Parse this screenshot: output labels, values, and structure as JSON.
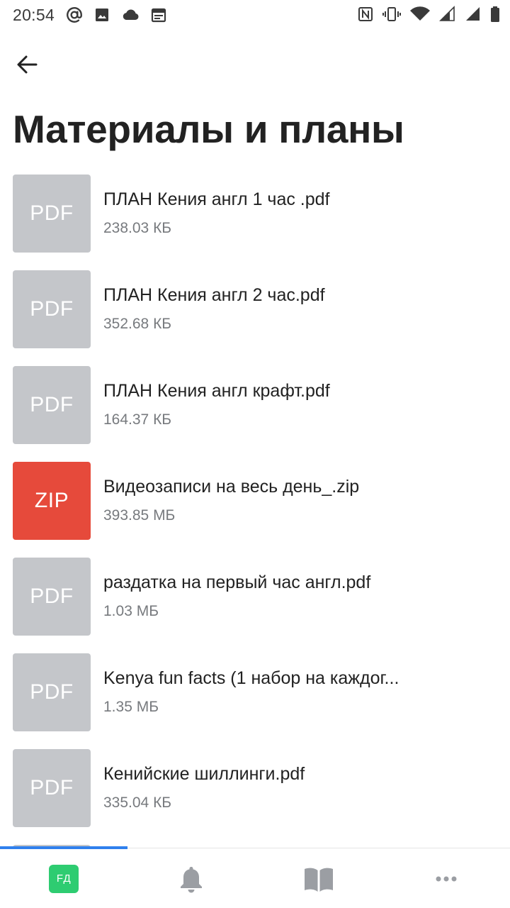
{
  "status_bar": {
    "time": "20:54",
    "left_icons": [
      "at-sign-icon",
      "image-icon",
      "cloud-icon",
      "calendar-icon"
    ],
    "right_icons": [
      "nfc-icon",
      "vibrate-icon",
      "wifi-icon",
      "signal-1-icon",
      "signal-2-icon",
      "battery-icon"
    ]
  },
  "header": {
    "back_icon": "arrow-left-icon",
    "title": "Материалы и планы"
  },
  "files": [
    {
      "type": "PDF",
      "name": "ПЛАН Кения англ 1 час .pdf",
      "size": "238.03 КБ"
    },
    {
      "type": "PDF",
      "name": "ПЛАН Кения англ 2 час.pdf",
      "size": "352.68 КБ"
    },
    {
      "type": "PDF",
      "name": "ПЛАН Кения англ крафт.pdf",
      "size": "164.37 КБ"
    },
    {
      "type": "ZIP",
      "name": "Видеозаписи на весь день_.zip",
      "size": "393.85 МБ"
    },
    {
      "type": "PDF",
      "name": "раздатка на первый час англ.pdf",
      "size": "1.03 МБ"
    },
    {
      "type": "PDF",
      "name": "Kenya fun facts (1 набор на каждог...",
      "size": "1.35 МБ"
    },
    {
      "type": "PDF",
      "name": "Кенийские шиллинги.pdf",
      "size": "335.04 КБ"
    }
  ],
  "colors": {
    "thumb_default": "#c4c6ca",
    "thumb_zip": "#e64a3b",
    "accent": "#2f80ed",
    "avatar": "#2ecc71",
    "nav_icon": "#9b9ea3"
  },
  "bottom_nav": {
    "scroll_progress": 0.25,
    "avatar_initials": "FД",
    "items": [
      "profile-avatar",
      "bell-icon",
      "book-icon",
      "more-dots-icon"
    ]
  }
}
